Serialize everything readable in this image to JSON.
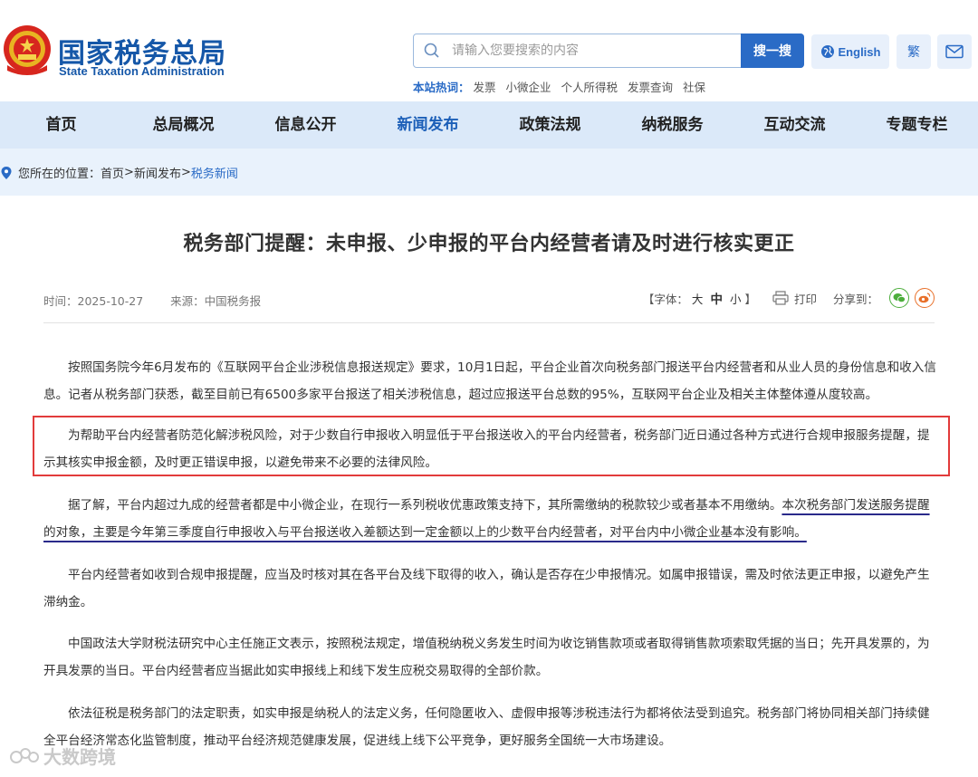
{
  "header": {
    "logo_cn": "国家税务总局",
    "logo_en": "State Taxation Administration",
    "search_placeholder": "请输入您要搜索的内容",
    "search_button": "搜一搜",
    "hot_label": "本站热词：",
    "hot_words": [
      "发票",
      "小微企业",
      "个人所得税",
      "发票查询",
      "社保"
    ],
    "english_label": "English",
    "traditional_label": "繁",
    "brand_color": "#1557a8"
  },
  "nav": {
    "items": [
      "首页",
      "总局概况",
      "信息公开",
      "新闻发布",
      "政策法规",
      "纳税服务",
      "互动交流",
      "专题专栏"
    ],
    "active": "新闻发布"
  },
  "breadcrumb": {
    "prefix": "您所在的位置：",
    "home": "首页",
    "sep1": ">",
    "section": "新闻发布",
    "sep2": ">",
    "current": "税务新闻"
  },
  "article": {
    "title": "税务部门提醒：未申报、少申报的平台内经营者请及时进行核实更正",
    "time_label": "时间：",
    "time": "2025-10-27",
    "source_label": "来源：",
    "source": "中国税务报",
    "font_label": "【字体：",
    "font_large": "大",
    "font_mid": "中",
    "font_small": "小",
    "font_close": "】",
    "print_label": "打印",
    "share_label": "分享到：",
    "p1": "按照国务院今年6月发布的《互联网平台企业涉税信息报送规定》要求，10月1日起，平台企业首次向税务部门报送平台内经营者和从业人员的身份信息和收入信息。记者从税务部门获悉，截至目前已有6500多家平台报送了相关涉税信息，超过应报送平台总数的95%，互联网平台企业及相关主体整体遵从度较高。",
    "p2": "为帮助平台内经营者防范化解涉税风险，对于少数自行申报收入明显低于平台报送收入的平台内经营者，税务部门近日通过各种方式进行合规申报服务提醒，提示其核实申报金额，及时更正错误申报，以避免带来不必要的法律风险。",
    "p3_a": "据了解，平台内超过九成的经营者都是中小微企业，在现行一系列税收优惠政策支持下，其所需缴纳的税款较少或者基本不用缴纳。",
    "p3_b": "本次税务部门发送服务提醒的对象，主要是今年第三季度自行申报收入与平台报送收入差额达到一定金额以上的少数平台内经营者，对平台内中小微企业基本没有影响。",
    "p4": "平台内经营者如收到合规申报提醒，应当及时核对其在各平台及线下取得的收入，确认是否存在少申报情况。如属申报错误，需及时依法更正申报，以避免产生滞纳金。",
    "p5": "中国政法大学财税法研究中心主任施正文表示，按照税法规定，增值税纳税义务发生时间为收讫销售款项或者取得销售款项索取凭据的当日；先开具发票的，为开具发票的当日。平台内经营者应当据此如实申报线上和线下发生应税交易取得的全部价款。",
    "p6": "依法征税是税务部门的法定职责，如实申报是纳税人的法定义务，任何隐匿收入、虚假申报等涉税违法行为都将依法受到追究。税务部门将协同相关部门持续健全平台经济常态化监管制度，推动平台经济规范健康发展，促进线上线下公平竞争，更好服务全国统一大市场建设。"
  },
  "watermark": "大数跨境"
}
